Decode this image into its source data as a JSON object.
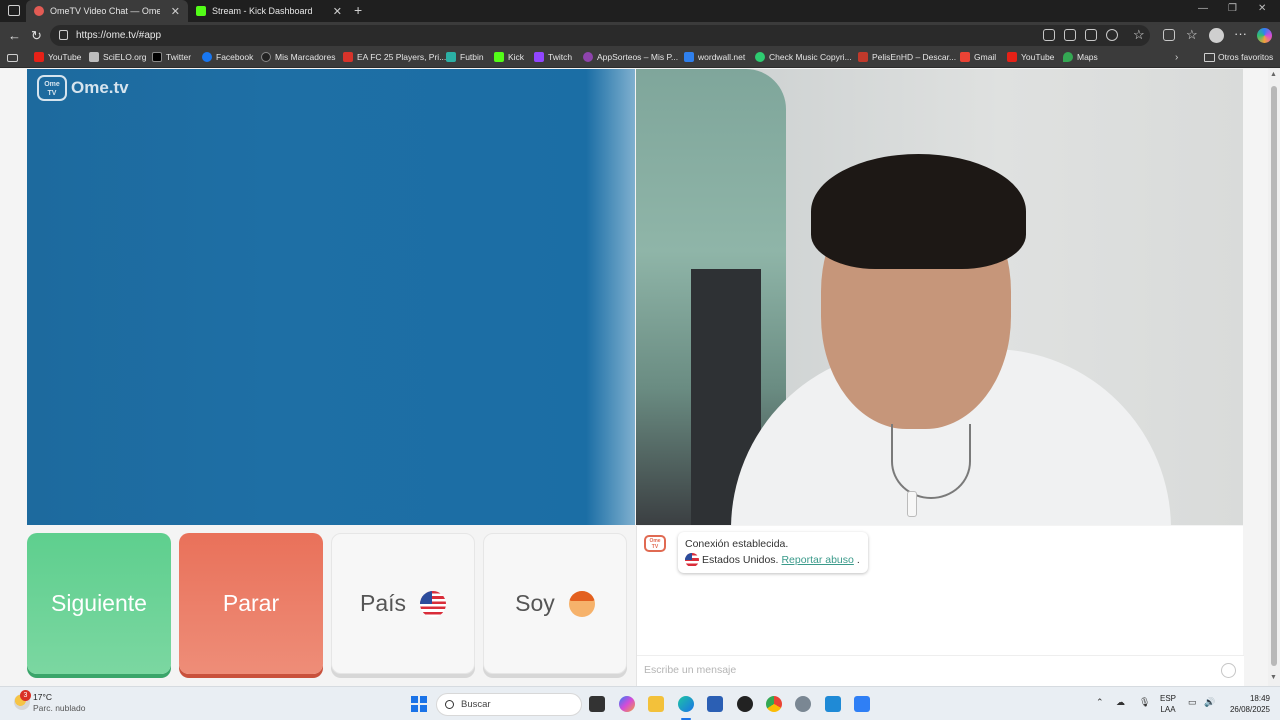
{
  "browser": {
    "tabs": [
      {
        "title": "OmeTV Video Chat — Omeg",
        "favicon_color": "#e25b54",
        "active": true
      },
      {
        "title": "Stream - Kick Dashboard",
        "favicon_color": "#53fc18",
        "active": false
      }
    ],
    "url": "https://ome.tv/#app",
    "bookmarks": [
      {
        "label": "YouTube",
        "icon_color": "#e62117"
      },
      {
        "label": "SciELO.org",
        "icon_color": "#bdbdbd"
      },
      {
        "label": "Twitter",
        "icon_color": "#000000"
      },
      {
        "label": "Facebook",
        "icon_color": "#1877f2"
      },
      {
        "label": "Mis Marcadores",
        "icon_color": "#222222"
      },
      {
        "label": "EA FC 25 Players, Pri...",
        "icon_color": "#d6332a"
      },
      {
        "label": "Futbin",
        "icon_color": "#2bb0a5"
      },
      {
        "label": "Kick",
        "icon_color": "#53fc18"
      },
      {
        "label": "Twitch",
        "icon_color": "#9146ff"
      },
      {
        "label": "AppSorteos – Mis P...",
        "icon_color": "#8e44ad"
      },
      {
        "label": "wordwall.net",
        "icon_color": "#2f80ed"
      },
      {
        "label": "Check Music Copyri...",
        "icon_color": "#2ecc71"
      },
      {
        "label": "PelisEnHD – Descar...",
        "icon_color": "#c0392b"
      },
      {
        "label": "Gmail",
        "icon_color": "#ea4335"
      },
      {
        "label": "YouTube",
        "icon_color": "#e62117"
      },
      {
        "label": "Maps",
        "icon_color": "#34a853"
      }
    ],
    "other_bookmarks": "Otros favoritos"
  },
  "app": {
    "logo_text": "Ome.tv",
    "logo_badge": "Ome TV",
    "buttons": {
      "next": "Siguiente",
      "stop": "Parar",
      "country": "País",
      "gender": "Soy"
    },
    "chat": {
      "system_line1": "Conexión establecida.",
      "country_text": "Estados Unidos.",
      "report_link": "Reportar abuso",
      "report_suffix": ".",
      "placeholder": "Escribe un mensaje"
    },
    "colors": {
      "next": "#5ecf8e",
      "stop": "#e9715a",
      "link": "#3a9a8a"
    }
  },
  "taskbar": {
    "weather_temp": "17°C",
    "weather_desc": "Parc. nublado",
    "weather_badge": "3",
    "search_label": "Buscar",
    "lang_line1": "ESP",
    "lang_line2": "LAA",
    "time": "18:49",
    "date": "26/08/2025"
  }
}
